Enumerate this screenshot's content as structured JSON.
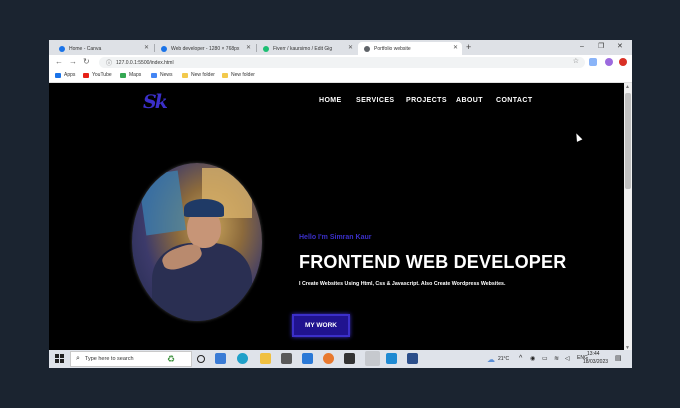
{
  "browser": {
    "tabs": [
      {
        "title": "Home - Canva",
        "color": "#1a73e8",
        "active": false
      },
      {
        "title": "Web developer - 1280 × 768px",
        "color": "#1a73e8",
        "active": false
      },
      {
        "title": "Fiverr / kaursimo / Edit Gig",
        "color": "#1dbf73",
        "active": false
      },
      {
        "title": "Portfolio website",
        "color": "#5f6368",
        "active": true
      }
    ],
    "new_tab_icon": "+",
    "window_controls": {
      "minimize": "–",
      "maximize": "❐",
      "close": "✕"
    },
    "nav": {
      "back": "←",
      "forward": "→",
      "reload": "↻"
    },
    "url": "127.0.0.1:5500/index.html",
    "bookmarks": [
      {
        "label": "Apps",
        "color": "#1a73e8"
      },
      {
        "label": "YouTube",
        "color": "#e62117"
      },
      {
        "label": "Maps",
        "color": "#34a853"
      },
      {
        "label": "News",
        "color": "#4285f4"
      },
      {
        "label": "New folder",
        "color": "#f2c94c"
      },
      {
        "label": "New folder",
        "color": "#f2c94c"
      }
    ]
  },
  "site": {
    "logo": "Sk",
    "nav": [
      "HOME",
      "SERVICES",
      "PROJECTS",
      "ABOUT",
      "CONTACT"
    ],
    "hello": "Hello I'm Simran Kaur",
    "headline": "FRONTEND WEB DEVELOPER",
    "subline": "I Create Websites Using Html, Css & Javascript. Also Create Wordpress Websites.",
    "cta": "MY WORK",
    "accent_color": "#3b2fc9",
    "background_color": "#000000"
  },
  "taskbar": {
    "search_placeholder": "Type here to search",
    "pinned_icons": [
      "task-view-icon",
      "widgets-icon",
      "edge-icon",
      "file-explorer-icon",
      "store-icon",
      "mail-icon",
      "firefox-icon",
      "camera-icon",
      "chrome-icon",
      "vscode-icon",
      "media-icon"
    ],
    "weather": "21°C",
    "time": "13:44",
    "date": "18/03/2023"
  }
}
